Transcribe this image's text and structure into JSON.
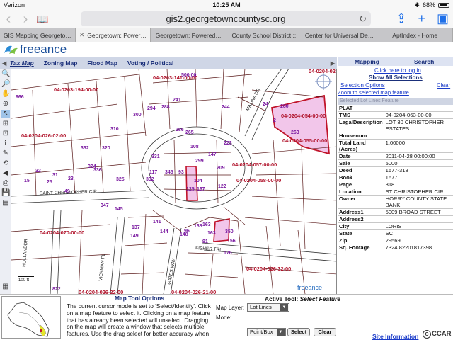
{
  "status": {
    "carrier": "Verizon",
    "time": "10:25 AM",
    "battery": "68%"
  },
  "browser": {
    "url": "gis2.georgetowncountysc.org",
    "tabs": [
      {
        "label": "GIS Mapping Georgeto…",
        "active": false
      },
      {
        "label": "Georgetown: Power…",
        "active": true
      },
      {
        "label": "Georgetown: Powered…",
        "active": false
      },
      {
        "label": "County School District ::",
        "active": false
      },
      {
        "label": "Center for Universal De…",
        "active": false
      },
      {
        "label": "AptIndex - Home",
        "active": false
      }
    ]
  },
  "app": {
    "logo": "freeance",
    "tools": [
      {
        "label": "Tax Map",
        "active": true
      },
      {
        "label": "Zoning Map",
        "active": false
      },
      {
        "label": "Flood Map",
        "active": false
      },
      {
        "label": "Voting / Political",
        "active": false
      }
    ],
    "watermark": "freeance",
    "scale_text": "100 ft"
  },
  "panel": {
    "mapping": "Mapping",
    "search": "Search",
    "login_link": "Click here to log in",
    "show_all": "Show All Selections",
    "selection_options": "Selection Options",
    "clear": "Clear",
    "zoom_link": "Zoom to selected map feature",
    "folded_label": "Selected Lot Lines Feature",
    "attributes": [
      {
        "key": "PLAT",
        "value": ""
      },
      {
        "key": "TMS",
        "value": "04-0204-063-00-00"
      },
      {
        "key": "LegalDescription",
        "value": "LOT 30 CHRISTOPHER ESTATES"
      },
      {
        "key": "Housenum",
        "value": ""
      },
      {
        "key": "Total Land (Acres)",
        "value": "1.00000"
      },
      {
        "key": "Date",
        "value": "2011-04-28 00:00:00"
      },
      {
        "key": "Sale",
        "value": "5000"
      },
      {
        "key": "Deed",
        "value": "1677-318"
      },
      {
        "key": "Book",
        "value": "1677"
      },
      {
        "key": "Page",
        "value": "318"
      },
      {
        "key": "Location",
        "value": "ST CHRISTOPHER CIR"
      },
      {
        "key": "Owner",
        "value": "HORRY COUNTY STATE BANK"
      },
      {
        "key": "Address1",
        "value": "5009 BROAD STREET"
      },
      {
        "key": "Address2",
        "value": ""
      },
      {
        "key": "City",
        "value": "LORIS"
      },
      {
        "key": "State",
        "value": "SC"
      },
      {
        "key": "Zip",
        "value": "29569"
      },
      {
        "key": "Sq. Footage",
        "value": "7324.82201817398"
      }
    ],
    "site_info": "Site Information",
    "ccar": "CCAR"
  },
  "bottom": {
    "title": "Map Tool Options",
    "text": "The current cursor mode is set to 'Select/Identify'. Click on a map feature to select it. Clicking on a map feature that has already been selected will unselect. Dragging on the map will create a window that selects multiple features. Use the drag select for better accuracy when",
    "active_tool_label": "Active Tool:",
    "active_tool_value": "Select Feature",
    "map_layer_label": "Map Layer:",
    "map_layer_value": "Lot Lines",
    "mode_label": "Mode:",
    "mode_value": "Point/Box",
    "select_btn": "Select",
    "clear_btn": "Clear"
  },
  "map_labels": {
    "parcels": [
      "04-0203-194-00-00",
      "04-0203-141-00-00",
      "04-0204-054-00-00",
      "04-0204-055-00-00",
      "04-0204-026-02-00",
      "04-0204-057-00-00",
      "04-0204-058-00-00",
      "04-0204-070-00-00",
      "04-0204-026-32-00",
      "04-0204-026-22-00",
      "04-0204-026-21-00",
      "04-0204-026-36-00"
    ],
    "numbers": [
      "966",
      "500.00",
      "300",
      "294",
      "288",
      "241",
      "244",
      "24",
      "280",
      "310",
      "286",
      "265",
      "223",
      "320",
      "108",
      "331",
      "117",
      "345",
      "93",
      "125",
      "104",
      "147",
      "209",
      "299",
      "332",
      "324",
      "336",
      "325",
      "332",
      "167",
      "122",
      "31",
      "32",
      "25",
      "23",
      "49",
      "15",
      "347",
      "145",
      "141",
      "144",
      "137",
      "149",
      "138",
      "148",
      "163",
      "163",
      "350",
      "156",
      "176",
      "822",
      "263",
      "2",
      "96",
      "91"
    ],
    "streets": [
      "SAINT CHRISTOPHER CIR",
      "VICKMAN PL",
      "GATES WAY",
      "FISHER TRL",
      "MALINA DR",
      "HOLLANDDR"
    ]
  }
}
